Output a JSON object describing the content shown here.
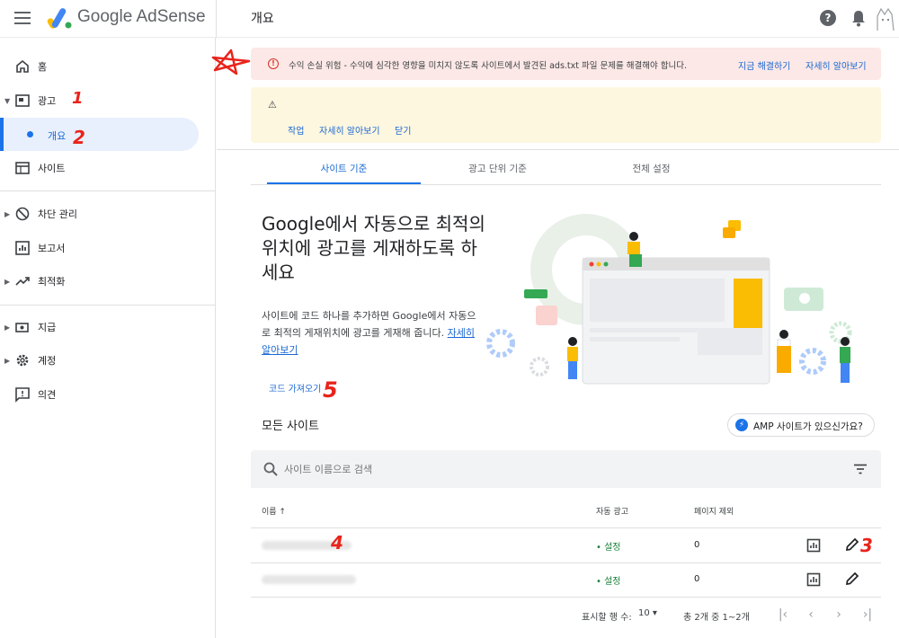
{
  "header": {
    "logo_text": "Google AdSense",
    "page_title": "개요",
    "help_icon": "?"
  },
  "sidebar": {
    "items": [
      {
        "label": "홈",
        "icon": "home-icon"
      },
      {
        "label": "광고",
        "icon": "ads-icon"
      },
      {
        "label": "개요",
        "icon": "dot-icon"
      },
      {
        "label": "사이트",
        "icon": "sites-icon"
      },
      {
        "label": "차단 관리",
        "icon": "block-icon"
      },
      {
        "label": "보고서",
        "icon": "reports-icon"
      },
      {
        "label": "최적화",
        "icon": "trending-icon"
      },
      {
        "label": "지급",
        "icon": "payments-icon"
      },
      {
        "label": "계정",
        "icon": "gear-icon"
      },
      {
        "label": "의견",
        "icon": "feedback-icon"
      }
    ]
  },
  "alerts": {
    "red_text": "수익 손실 위험 - 수익에 심각한 영향을 미치지 않도록 사이트에서 발견된 ads.txt 파일 문제를 해결해야 합니다.",
    "fix_now": "지금 해결하기",
    "learn_more": "자세히 알아보기",
    "yellow_actions": [
      "작업",
      "자세히 알아보기",
      "닫기"
    ]
  },
  "tabs": [
    "사이트 기준",
    "광고 단위 기준",
    "전체 설정"
  ],
  "hero": {
    "title": "Google에서 자동으로 최적의 위치에 광고를 게재하도록 하세요",
    "desc": "사이트에 코드 하나를 추가하면 Google에서 자동으로 최적의 게재위치에 광고를 게재해 줍니다.",
    "desc_link": "자세히 알아보기",
    "get_code": "코드 가져오기"
  },
  "sites": {
    "heading": "모든 사이트",
    "amp_button": "AMP 사이트가 있으신가요?",
    "search_placeholder": "사이트 이름으로 검색",
    "columns": [
      "이름 ↑",
      "자동 광고",
      "페이지 제외"
    ],
    "rows": [
      {
        "status": "• 설정",
        "excluded": "0"
      },
      {
        "status": "• 설정",
        "excluded": "0"
      }
    ],
    "pagination": {
      "rows_label": "표시할 행 수:",
      "rows_value": "10 ▾",
      "range": "총 2개 중 1~2개"
    }
  },
  "annotations": [
    "1",
    "2",
    "3",
    "4",
    "5",
    "☆"
  ],
  "colors": {
    "accent": "#1a73e8",
    "alert_red": "#fce8e6",
    "alert_yellow": "#fef7e0",
    "annotation": "#e8241b"
  }
}
